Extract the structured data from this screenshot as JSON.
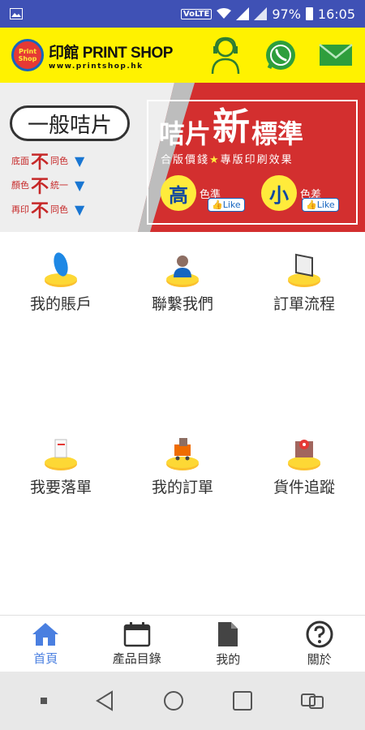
{
  "status_bar": {
    "volte": "VoLTE",
    "battery_percent": "97%",
    "time": "16:05",
    "icons": [
      "image-icon",
      "wifi-icon",
      "signal-icon",
      "battery-icon"
    ]
  },
  "header": {
    "logo_text": "Print Shop",
    "brand_name": "印館 PRINT SHOP",
    "brand_url": "www.printshop.hk",
    "icons": [
      "customer-service-icon",
      "whatsapp-icon",
      "mail-icon"
    ]
  },
  "banner": {
    "left_title": "一般咭片",
    "left_rows": [
      {
        "a": "底面",
        "b": "不",
        "c": "同色"
      },
      {
        "a": "顏色",
        "b": "不",
        "c": "統一"
      },
      {
        "a": "再印",
        "b": "不",
        "c": "同色"
      }
    ],
    "right_title_1": "咭片",
    "right_title_2": "新",
    "right_title_3": "標準",
    "right_subtitle_1": "合版價錢",
    "right_subtitle_2": "專版印刷效果",
    "badge1_big": "高",
    "badge1_small": "色準",
    "badge2_big": "小",
    "badge2_small": "色差",
    "like_label": "Like"
  },
  "menu": {
    "items": [
      {
        "label": "我的賬戶",
        "icon": "account-icon"
      },
      {
        "label": "聯繫我們",
        "icon": "contact-icon"
      },
      {
        "label": "訂單流程",
        "icon": "order-process-icon"
      },
      {
        "label": "我要落單",
        "icon": "place-order-icon"
      },
      {
        "label": "我的訂單",
        "icon": "my-orders-icon"
      },
      {
        "label": "貨件追蹤",
        "icon": "tracking-icon"
      }
    ]
  },
  "tabs": [
    {
      "label": "首頁",
      "icon": "home-icon",
      "active": true
    },
    {
      "label": "產品目錄",
      "icon": "calendar-icon",
      "active": false
    },
    {
      "label": "我的",
      "icon": "document-icon",
      "active": false
    },
    {
      "label": "關於",
      "icon": "help-icon",
      "active": false
    }
  ],
  "colors": {
    "status_bar": "#3f51b5",
    "header_bg": "#fff200",
    "banner_red": "#d32f2f",
    "active_tab": "#4a7fe0"
  }
}
